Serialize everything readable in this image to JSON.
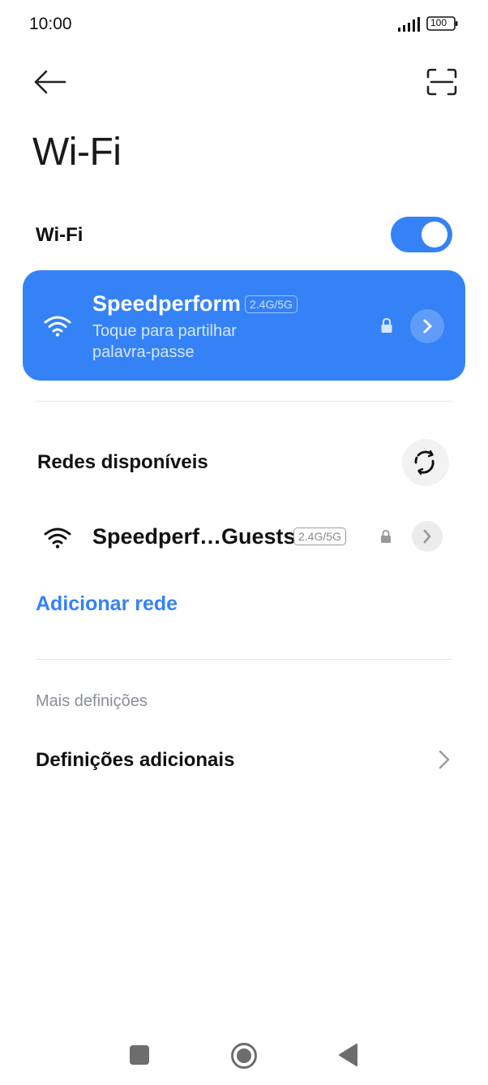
{
  "status_bar": {
    "time": "10:00",
    "battery": "100"
  },
  "header": {
    "title": "Wi-Fi"
  },
  "wifi_toggle": {
    "label": "Wi-Fi",
    "state": "on"
  },
  "connected_network": {
    "ssid": "Speedperform",
    "band": "2.4G/5G",
    "subtitle_line1": "Toque para partilhar",
    "subtitle_line2": "palavra-passe"
  },
  "available_networks": {
    "title": "Redes disponíveis",
    "items": [
      {
        "ssid": "Speedperf…Guests",
        "band": "2.4G/5G"
      }
    ]
  },
  "add_network": {
    "label": "Adicionar rede"
  },
  "more_settings": {
    "header": "Mais definições",
    "items": [
      {
        "label": "Definições adicionais"
      }
    ]
  },
  "colors": {
    "accent": "#3482f6",
    "toggle_on": "#3482f6"
  }
}
